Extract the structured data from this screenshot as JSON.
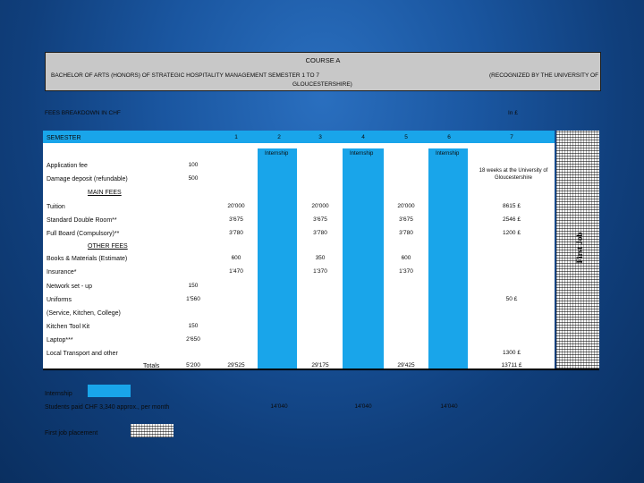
{
  "course": {
    "title": "COURSE A",
    "program": "BACHELOR OF ARTS (HONORS) OF STRATEGIC HOSPITALITY MANAGEMENT SEMESTER 1 TO 7",
    "program_cont": "GLOUCESTERSHIRE)",
    "recognized": "(RECOGNIZED BY THE UNIVERSITY OF"
  },
  "fees": {
    "heading": "FEES BREAKDOWN IN CHF",
    "currency": "In £"
  },
  "semester": {
    "label": "SEMESTER",
    "numbers": [
      "1",
      "2",
      "3",
      "4",
      "5",
      "6",
      "7"
    ],
    "internship_label": "Internship"
  },
  "rows": {
    "application_fee": {
      "label": "Application fee",
      "value": "100"
    },
    "damage_deposit": {
      "label": "Damage deposit (refundable)",
      "value": "500"
    },
    "uk_note": "18 weeks at the University of Gloucestershire",
    "main_fees": "MAIN FEES",
    "tuition": {
      "label": "Tuition",
      "s1": "20'000",
      "s3": "20'000",
      "s5": "20'000",
      "s7": "8615 £"
    },
    "room": {
      "label": "Standard Double Room**",
      "s1": "3'675",
      "s3": "3'675",
      "s5": "3'675",
      "s7": "2546 £"
    },
    "board": {
      "label": "Full Board (Compulsory)**",
      "s1": "3'780",
      "s3": "3'780",
      "s5": "3'780",
      "s7": "1200 £"
    },
    "other_fees": "OTHER FEES",
    "books": {
      "label": "Books & Materials (Estimate)",
      "s1": "600",
      "s3": "350",
      "s5": "600"
    },
    "insurance": {
      "label": "Insurance*",
      "s1": "1'470",
      "s3": "1'370",
      "s5": "1'370"
    },
    "network": {
      "label": "Network set - up",
      "value": "150"
    },
    "uniforms": {
      "label": "Uniforms",
      "value": "1'560",
      "s7": "50 £"
    },
    "uniforms_sub": "(Service, Kitchen, College)",
    "kitchen": {
      "label": "Kitchen Tool Kit",
      "value": "150"
    },
    "laptop": {
      "label": "Laptop***",
      "value": "2'650"
    },
    "transport": {
      "label": "Local Transport and other",
      "s7": "1300 £"
    },
    "totals": {
      "label": "Totals",
      "pre": "5'200",
      "s1": "29'525",
      "s3": "29'175",
      "s5": "29'425",
      "s7": "13711 £"
    }
  },
  "legend": {
    "internship": "Internship",
    "students_paid": "Students paid CHF 3,340 approx., per month",
    "s2": "14'040",
    "s4": "14'040",
    "s6": "14'040",
    "first_job": "First job placement"
  },
  "side_label": "First Job",
  "colors": {
    "accent_blue": "#19a5ea",
    "header_gray": "#c8c8c8"
  }
}
